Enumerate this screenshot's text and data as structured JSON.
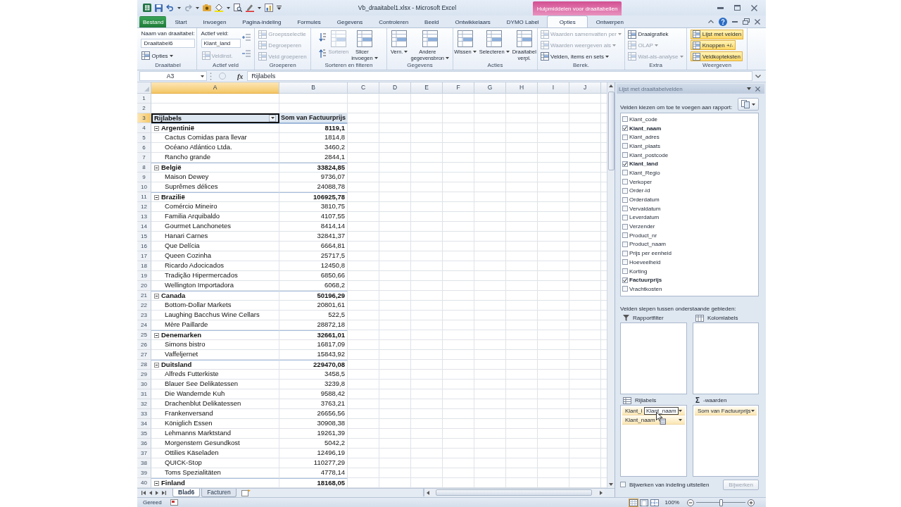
{
  "window": {
    "title": "Vb_draaitabel1.xlsx - Microsoft Excel",
    "context_group": "Hulpmiddelen voor draaitabellen"
  },
  "tabs": [
    {
      "label": "Bestand",
      "kind": "file",
      "selected": false
    },
    {
      "label": "Start",
      "kind": "standard",
      "selected": false
    },
    {
      "label": "Invoegen",
      "kind": "standard",
      "selected": false
    },
    {
      "label": "Pagina-indeling",
      "kind": "standard",
      "selected": false
    },
    {
      "label": "Formules",
      "kind": "standard",
      "selected": false
    },
    {
      "label": "Gegevens",
      "kind": "standard",
      "selected": false
    },
    {
      "label": "Controleren",
      "kind": "standard",
      "selected": false
    },
    {
      "label": "Beeld",
      "kind": "standard",
      "selected": false
    },
    {
      "label": "Ontwikkelaars",
      "kind": "standard",
      "selected": false
    },
    {
      "label": "DYMO Label",
      "kind": "standard",
      "selected": false
    },
    {
      "label": "Opties",
      "kind": "standard",
      "selected": true
    },
    {
      "label": "Ontwerpen",
      "kind": "standard",
      "selected": false
    }
  ],
  "ribbon": {
    "groups": [
      {
        "label": "Draaitabel",
        "columns": [
          [
            {
              "kind": "label",
              "text": "Naam van draaitabel:"
            },
            {
              "kind": "field",
              "value": "Draaitabel6"
            },
            {
              "kind": "small",
              "label": "Opties",
              "dropdown": true,
              "disabled": false
            }
          ]
        ]
      },
      {
        "label": "Actief veld",
        "columns": [
          [
            {
              "kind": "label",
              "text": "Actief veld:"
            },
            {
              "kind": "field",
              "value": "Klant_land"
            },
            {
              "kind": "small",
              "label": "Veldinst.",
              "dropdown": false,
              "disabled": true
            }
          ],
          [
            {
              "kind": "expand",
              "disabled": false
            },
            {
              "kind": "expand",
              "disabled": false
            }
          ]
        ]
      },
      {
        "label": "Groeperen",
        "columns": [
          [
            {
              "kind": "small",
              "label": "Groepsselectie",
              "dropdown": false,
              "disabled": true
            },
            {
              "kind": "small",
              "label": "Degroeperen",
              "dropdown": false,
              "disabled": true
            },
            {
              "kind": "small",
              "label": "Veld groeperen",
              "dropdown": false,
              "disabled": true
            }
          ]
        ]
      },
      {
        "label": "Sorteren en filteren",
        "columns": [
          [
            {
              "kind": "sort",
              "disabled": false
            },
            {
              "kind": "sort",
              "disabled": false
            }
          ],
          [
            {
              "kind": "large",
              "label": "Sorteren",
              "dropdown": false,
              "disabled": true
            }
          ],
          [
            {
              "kind": "large",
              "label": "Slicer invoegen",
              "dropdown": true,
              "disabled": false
            }
          ]
        ]
      },
      {
        "label": "Gegevens",
        "columns": [
          [
            {
              "kind": "large",
              "label": "Vern.",
              "dropdown": true,
              "disabled": false
            }
          ],
          [
            {
              "kind": "large",
              "label": "Andere gegevensbron",
              "dropdown": true,
              "disabled": false
            }
          ]
        ]
      },
      {
        "label": "Acties",
        "columns": [
          [
            {
              "kind": "large",
              "label": "Wissen",
              "dropdown": true,
              "disabled": false
            }
          ],
          [
            {
              "kind": "large",
              "label": "Selecteren",
              "dropdown": true,
              "disabled": false
            }
          ],
          [
            {
              "kind": "large",
              "label": "Draaitabel verpl.",
              "dropdown": false,
              "disabled": false
            }
          ]
        ]
      },
      {
        "label": "Berek.",
        "columns": [
          [
            {
              "kind": "small",
              "label": "Waarden samenvatten per",
              "dropdown": true,
              "disabled": true
            },
            {
              "kind": "small",
              "label": "Waarden weergeven als",
              "dropdown": true,
              "disabled": true
            },
            {
              "kind": "small",
              "label": "Velden, items en sets",
              "dropdown": true,
              "disabled": false
            }
          ]
        ]
      },
      {
        "label": "Extra",
        "columns": [
          [
            {
              "kind": "small",
              "label": "Draaigrafiek",
              "dropdown": false,
              "disabled": false
            },
            {
              "kind": "small",
              "label": "OLAP",
              "dropdown": true,
              "disabled": true
            },
            {
              "kind": "small",
              "label": "Wat-als-analyse",
              "dropdown": true,
              "disabled": true
            }
          ]
        ]
      },
      {
        "label": "Weergeven",
        "columns": [
          [
            {
              "kind": "toggle",
              "label": "Lijst met velden",
              "on": true
            },
            {
              "kind": "toggle",
              "label": "Knoppen +/-",
              "on": true
            },
            {
              "kind": "toggle",
              "label": "Veldkopteksten",
              "on": true
            }
          ]
        ]
      }
    ]
  },
  "formula_bar": {
    "name_box": "A3",
    "function_button": "fx",
    "formula": "Rijlabels"
  },
  "sheet": {
    "columns": [
      {
        "label": "A",
        "selected": true
      },
      {
        "label": "B",
        "selected": false
      },
      {
        "label": "C",
        "selected": false
      },
      {
        "label": "D",
        "selected": false
      },
      {
        "label": "E",
        "selected": false
      },
      {
        "label": "F",
        "selected": false
      },
      {
        "label": "G",
        "selected": false
      },
      {
        "label": "H",
        "selected": false
      },
      {
        "label": "I",
        "selected": false
      },
      {
        "label": "J",
        "selected": false
      }
    ],
    "row_numbers": [
      {
        "label": "1",
        "selected": false
      },
      {
        "label": "2",
        "selected": false
      },
      {
        "label": "3",
        "selected": true
      },
      {
        "label": "4",
        "selected": false
      },
      {
        "label": "5",
        "selected": false
      },
      {
        "label": "6",
        "selected": false
      },
      {
        "label": "7",
        "selected": false
      },
      {
        "label": "8",
        "selected": false
      },
      {
        "label": "9",
        "selected": false
      },
      {
        "label": "10",
        "selected": false
      },
      {
        "label": "11",
        "selected": false
      },
      {
        "label": "12",
        "selected": false
      },
      {
        "label": "13",
        "selected": false
      },
      {
        "label": "14",
        "selected": false
      },
      {
        "label": "15",
        "selected": false
      },
      {
        "label": "16",
        "selected": false
      },
      {
        "label": "17",
        "selected": false
      },
      {
        "label": "18",
        "selected": false
      },
      {
        "label": "19",
        "selected": false
      },
      {
        "label": "20",
        "selected": false
      },
      {
        "label": "21",
        "selected": false
      },
      {
        "label": "22",
        "selected": false
      },
      {
        "label": "23",
        "selected": false
      },
      {
        "label": "24",
        "selected": false
      },
      {
        "label": "25",
        "selected": false
      },
      {
        "label": "26",
        "selected": false
      },
      {
        "label": "27",
        "selected": false
      },
      {
        "label": "28",
        "selected": false
      },
      {
        "label": "29",
        "selected": false
      },
      {
        "label": "30",
        "selected": false
      },
      {
        "label": "31",
        "selected": false
      },
      {
        "label": "32",
        "selected": false
      },
      {
        "label": "33",
        "selected": false
      },
      {
        "label": "34",
        "selected": false
      },
      {
        "label": "35",
        "selected": false
      },
      {
        "label": "36",
        "selected": false
      },
      {
        "label": "37",
        "selected": false
      },
      {
        "label": "38",
        "selected": false
      },
      {
        "label": "39",
        "selected": false
      },
      {
        "label": "40",
        "selected": false
      }
    ],
    "pivot": {
      "row_header": "Rijlabels",
      "value_header": "Som van Factuurprijs",
      "groups": [
        {
          "label": "Argentinië",
          "value": "8119,1",
          "expanded": true,
          "children": [
            {
              "label": "Cactus Comidas para llevar",
              "value": "1814,8"
            },
            {
              "label": "Océano Atlántico Ltda.",
              "value": "3460,2"
            },
            {
              "label": "Rancho grande",
              "value": "2844,1"
            }
          ]
        },
        {
          "label": "België",
          "value": "33824,85",
          "expanded": true,
          "children": [
            {
              "label": "Maison Dewey",
              "value": "9736,07"
            },
            {
              "label": "Suprêmes délices",
              "value": "24088,78"
            }
          ]
        },
        {
          "label": "Brazilië",
          "value": "106925,78",
          "expanded": true,
          "children": [
            {
              "label": "Comércio Mineiro",
              "value": "3810,75"
            },
            {
              "label": "Familia Arquibaldo",
              "value": "4107,55"
            },
            {
              "label": "Gourmet Lanchonetes",
              "value": "8414,14"
            },
            {
              "label": "Hanari Carnes",
              "value": "32841,37"
            },
            {
              "label": "Que Delícia",
              "value": "6664,81"
            },
            {
              "label": "Queen Cozinha",
              "value": "25717,5"
            },
            {
              "label": "Ricardo Adocicados",
              "value": "12450,8"
            },
            {
              "label": "Tradição Hipermercados",
              "value": "6850,66"
            },
            {
              "label": "Wellington Importadora",
              "value": "6068,2"
            }
          ]
        },
        {
          "label": "Canada",
          "value": "50196,29",
          "expanded": true,
          "children": [
            {
              "label": "Bottom-Dollar Markets",
              "value": "20801,61"
            },
            {
              "label": "Laughing Bacchus Wine Cellars",
              "value": "522,5"
            },
            {
              "label": "Mère Paillarde",
              "value": "28872,18"
            }
          ]
        },
        {
          "label": "Denemarken",
          "value": "32661,01",
          "expanded": true,
          "children": [
            {
              "label": "Simons bistro",
              "value": "16817,09"
            },
            {
              "label": "Vaffeljernet",
              "value": "15843,92"
            }
          ]
        },
        {
          "label": "Duitsland",
          "value": "229470,08",
          "expanded": true,
          "children": [
            {
              "label": "Alfreds Futterkiste",
              "value": "3458,5"
            },
            {
              "label": "Blauer See Delikatessen",
              "value": "3239,8"
            },
            {
              "label": "Die Wandernde Kuh",
              "value": "9588,42"
            },
            {
              "label": "Drachenblut Delikatessen",
              "value": "3763,21"
            },
            {
              "label": "Frankenversand",
              "value": "26656,56"
            },
            {
              "label": "Königlich Essen",
              "value": "30908,38"
            },
            {
              "label": "Lehmanns Marktstand",
              "value": "19261,39"
            },
            {
              "label": "Morgenstern Gesundkost",
              "value": "5042,2"
            },
            {
              "label": "Ottilies Käseladen",
              "value": "12496,19"
            },
            {
              "label": "QUICK-Stop",
              "value": "110277,29"
            },
            {
              "label": "Toms Spezialitäten",
              "value": "4778,14"
            }
          ]
        },
        {
          "label": "Finland",
          "value": "18168,05",
          "expanded": true
        }
      ]
    }
  },
  "sheet_tabs": [
    {
      "label": "Blad6",
      "selected": true
    },
    {
      "label": "Facturen",
      "selected": false
    }
  ],
  "field_list": {
    "title": "Lijst met draaitabelvelden",
    "choose_label": "Velden kiezen om toe te voegen aan rapport:",
    "fields": [
      {
        "label": "Klant_code",
        "checked": false
      },
      {
        "label": "Klant_naam",
        "checked": true
      },
      {
        "label": "Klant_adres",
        "checked": false
      },
      {
        "label": "Klant_plaats",
        "checked": false
      },
      {
        "label": "Klant_postcode",
        "checked": false
      },
      {
        "label": "Klant_land",
        "checked": true
      },
      {
        "label": "Klant_Regio",
        "checked": false
      },
      {
        "label": "Verkoper",
        "checked": false
      },
      {
        "label": "Order-id",
        "checked": false
      },
      {
        "label": "Orderdatum",
        "checked": false
      },
      {
        "label": "Vervaldatum",
        "checked": false
      },
      {
        "label": "Leverdatum",
        "checked": false
      },
      {
        "label": "Verzender",
        "checked": false
      },
      {
        "label": "Product_nr",
        "checked": false
      },
      {
        "label": "Product_naam",
        "checked": false
      },
      {
        "label": "Prijs per eenheid",
        "checked": false
      },
      {
        "label": "Hoeveelheid",
        "checked": false
      },
      {
        "label": "Korting",
        "checked": false
      },
      {
        "label": "Factuurprijs",
        "checked": true
      },
      {
        "label": "Vrachtkosten",
        "checked": false
      }
    ],
    "drag_label": "Velden slepen tussen onderstaande gebieden:",
    "areas": [
      {
        "kind": "filter",
        "label": "Rapportfilter"
      },
      {
        "kind": "columns",
        "label": "Kolomlabels"
      },
      {
        "kind": "rows",
        "label": "Rijlabels",
        "items": [
          {
            "label": "Klant_l"
          },
          {
            "label": "Klant_naam"
          }
        ]
      },
      {
        "kind": "values",
        "symbol": "Σ",
        "label": "-waarden",
        "items": [
          {
            "label": "Som van Factuurprijs"
          }
        ]
      }
    ],
    "drag_item": "Klant_naam",
    "defer_update": {
      "label": "Bijwerken van indeling uitstellen",
      "checked": false
    },
    "update_button": {
      "label": "Bijwerken",
      "disabled": true
    }
  },
  "status_bar": {
    "status": "Gereed",
    "views": [
      {
        "selected": true
      },
      {
        "selected": false
      },
      {
        "selected": false
      }
    ],
    "zoom": "100%",
    "zoom_slider": {
      "level": 0.5
    }
  }
}
